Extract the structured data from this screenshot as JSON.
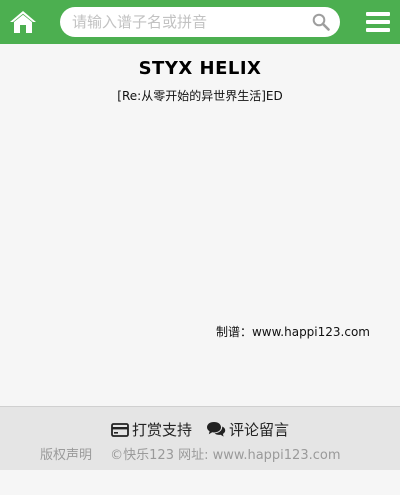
{
  "header": {
    "brand_color": "#4caf50",
    "home_icon": "home-icon",
    "search": {
      "placeholder": "请输入谱子名或拼音",
      "value": ""
    },
    "search_icon": "search-icon",
    "menu_icon": "menu-icon"
  },
  "song": {
    "title": "STYX HELIX",
    "subtitle": "[Re:从零开始的异世界生活]ED",
    "maker": "制谱：www.happi123.com"
  },
  "footer": {
    "reward_label": "打赏支持",
    "reward_icon": "credit-card-icon",
    "comment_label": "评论留言",
    "comment_icon": "comments-icon",
    "copyright_label": "版权声明",
    "site_label": "©快乐123 网址: www.happi123.com"
  }
}
